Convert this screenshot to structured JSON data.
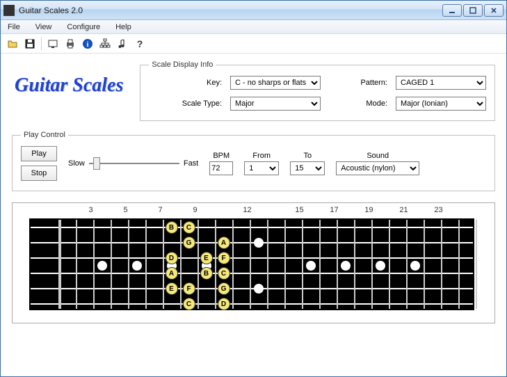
{
  "window": {
    "title": "Guitar Scales 2.0"
  },
  "menu": {
    "file": "File",
    "view": "View",
    "configure": "Configure",
    "help": "Help"
  },
  "brand": "Guitar Scales",
  "scale_info": {
    "legend": "Scale Display Info",
    "key_label": "Key:",
    "key_value": "C  - no sharps or flats",
    "pattern_label": "Pattern:",
    "pattern_value": "CAGED 1",
    "scaletype_label": "Scale Type:",
    "scaletype_value": "Major",
    "mode_label": "Mode:",
    "mode_value": "Major (Ionian)"
  },
  "play": {
    "legend": "Play Control",
    "play_btn": "Play",
    "stop_btn": "Stop",
    "slow": "Slow",
    "fast": "Fast",
    "bpm_label": "BPM",
    "bpm_value": "72",
    "from_label": "From",
    "from_value": "1",
    "to_label": "To",
    "to_value": "15",
    "sound_label": "Sound",
    "sound_value": "Acoustic (nylon)"
  },
  "fret_markers": [
    "3",
    "5",
    "7",
    "9",
    "12",
    "15",
    "17",
    "19",
    "21",
    "23"
  ],
  "fret_marker_positions": [
    3,
    5,
    7,
    9,
    12,
    15,
    17,
    19,
    21,
    23
  ],
  "inlays_single": [
    3,
    5,
    7,
    9,
    15,
    17,
    19,
    21
  ],
  "inlays_double": [
    12
  ],
  "chart_data": {
    "type": "diagram",
    "title": "Guitar fretboard scale positions",
    "tuning_strings": 6,
    "frets_shown": 24,
    "notes": [
      {
        "string": 1,
        "fret": 7,
        "label": "B"
      },
      {
        "string": 1,
        "fret": 8,
        "label": "C"
      },
      {
        "string": 2,
        "fret": 8,
        "label": "G"
      },
      {
        "string": 2,
        "fret": 10,
        "label": "A"
      },
      {
        "string": 3,
        "fret": 7,
        "label": "D"
      },
      {
        "string": 3,
        "fret": 9,
        "label": "E"
      },
      {
        "string": 3,
        "fret": 10,
        "label": "F"
      },
      {
        "string": 4,
        "fret": 7,
        "label": "A"
      },
      {
        "string": 4,
        "fret": 9,
        "label": "B"
      },
      {
        "string": 4,
        "fret": 10,
        "label": "C"
      },
      {
        "string": 5,
        "fret": 7,
        "label": "E"
      },
      {
        "string": 5,
        "fret": 8,
        "label": "F"
      },
      {
        "string": 5,
        "fret": 10,
        "label": "G"
      },
      {
        "string": 6,
        "fret": 8,
        "label": "C"
      },
      {
        "string": 6,
        "fret": 10,
        "label": "D"
      }
    ]
  }
}
